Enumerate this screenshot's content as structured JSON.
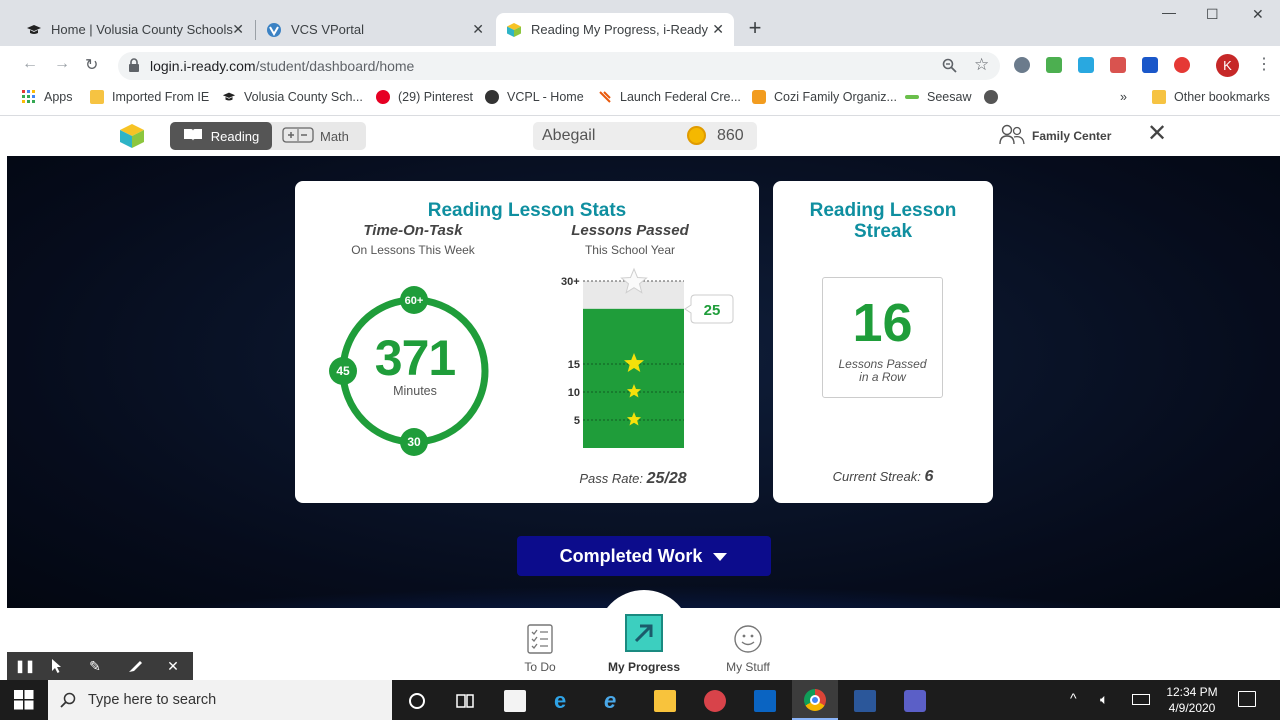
{
  "browser": {
    "tabs": [
      {
        "title": "Home | Volusia County Schools",
        "active": false
      },
      {
        "title": "VCS VPortal",
        "active": false
      },
      {
        "title": "Reading My Progress, i-Ready",
        "active": true
      }
    ],
    "url_host": "login.i-ready.com",
    "url_path": "/student/dashboard/home",
    "bookmarks": [
      "Apps",
      "Imported From IE",
      "Volusia County Sch...",
      "(29) Pinterest",
      "VCPL - Home",
      "Launch Federal Cre...",
      "Cozi Family Organiz...",
      "Seesaw"
    ],
    "bookmarks_more": "»",
    "other_bookmarks": "Other bookmarks",
    "profile_initial": "K"
  },
  "app": {
    "reading_label": "Reading",
    "math_label": "Math",
    "student_name": "Abegail",
    "coins": "860",
    "family_center": "Family Center",
    "stats": {
      "title": "Reading Lesson Stats",
      "time_title": "Time-On-Task",
      "time_sub": "On Lessons This Week",
      "minutes_value": "371",
      "minutes_label": "Minutes",
      "ring_labels": {
        "top": "60+",
        "left": "45",
        "bottom": "30"
      },
      "ring_progress_fraction": 0.97,
      "lessons_title": "Lessons Passed",
      "lessons_sub": "This School Year",
      "bar_value": 25,
      "bar_max": 30,
      "bar_value_label": "25",
      "bar_top_label": "30+",
      "bar_ticks": [
        "15",
        "10",
        "5"
      ],
      "pass_rate_label": "Pass Rate:",
      "pass_rate_value": "25/28"
    },
    "streak": {
      "title_line1": "Reading Lesson",
      "title_line2": "Streak",
      "value": "16",
      "label_line1": "Lessons Passed",
      "label_line2": "in a Row",
      "current_label": "Current Streak:",
      "current_value": "6"
    },
    "completed_work": "Completed Work",
    "nav": {
      "todo": "To Do",
      "progress": "My Progress",
      "stuff": "My Stuff"
    }
  },
  "taskbar": {
    "search_placeholder": "Type here to search",
    "time": "12:34 PM",
    "date": "4/9/2020"
  },
  "colors": {
    "accent_teal": "#0f8fa0",
    "green": "#1f9d3a",
    "navy_button": "#0c0c8c"
  }
}
